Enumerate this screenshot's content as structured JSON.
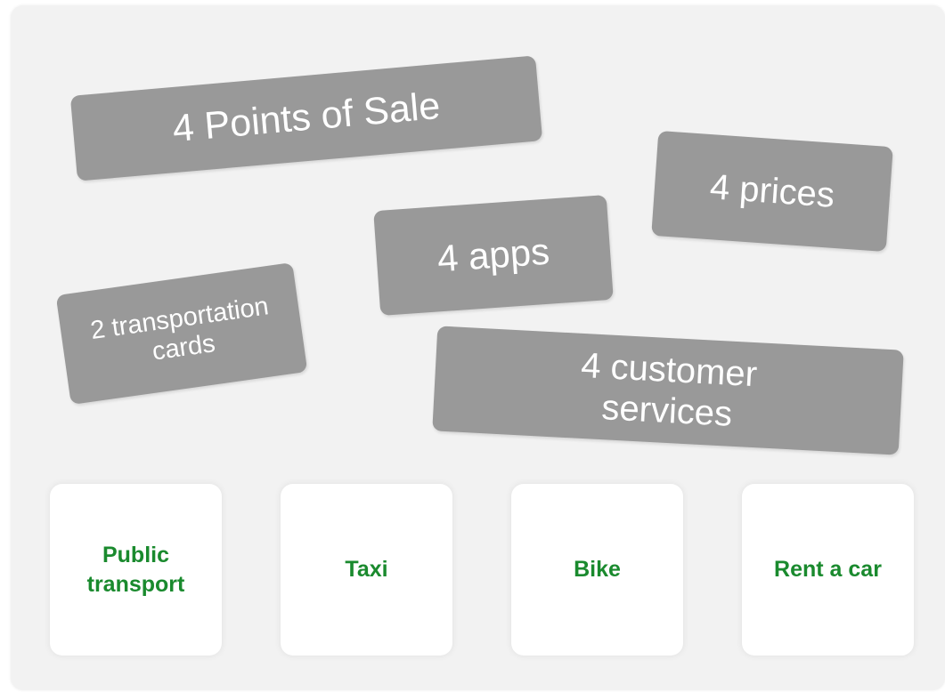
{
  "tags": {
    "points_of_sale": "4 Points of Sale",
    "prices": "4 prices",
    "apps": "4 apps",
    "transportation_cards_line1": "2 transportation",
    "transportation_cards_line2": "cards",
    "customer_services_line1": "4 customer",
    "customer_services_line2": "services"
  },
  "modes": {
    "public_transport_line1": "Public",
    "public_transport_line2": "transport",
    "taxi": "Taxi",
    "bike": "Bike",
    "rent_a_car": "Rent a car"
  },
  "colors": {
    "panel_background": "#f2f2f2",
    "tag_background": "#999999",
    "tag_text": "#ffffff",
    "mode_background": "#ffffff",
    "mode_text": "#1a8a2e"
  }
}
